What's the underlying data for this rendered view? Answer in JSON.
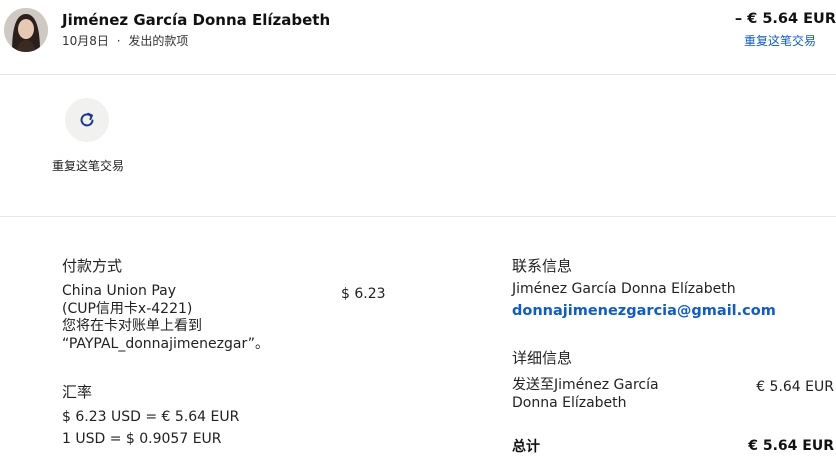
{
  "header": {
    "name": "Jiménez García Donna Elízabeth",
    "date": "10月8日",
    "separator": "·",
    "type": "发出的款项",
    "amount": "– € 5.64 EUR",
    "repeat_link": "重复这笔交易"
  },
  "actions": {
    "repeat_label": "重复这笔交易"
  },
  "payment": {
    "heading": "付款方式",
    "method_lines": [
      "China Union Pay",
      "(CUP信用卡x-4221)",
      "您将在卡对账单上看到",
      "“PAYPAL_donnajimenezgar”。"
    ],
    "method_amount": "$ 6.23"
  },
  "exchange": {
    "heading": "汇率",
    "line1": "$ 6.23 USD = € 5.64 EUR",
    "line2": "1 USD = $ 0.9057 EUR"
  },
  "contact": {
    "heading": "联系信息",
    "name": "Jiménez García Donna Elízabeth",
    "email": "donnajimenezgarcia@gmail.com"
  },
  "details": {
    "heading": "详细信息",
    "sent_to_lines": [
      "发送至Jiménez García",
      "Donna Elízabeth"
    ],
    "sent_amount": "€ 5.64 EUR",
    "total_label": "总计",
    "total_amount": "€ 5.64 EUR"
  },
  "colors": {
    "link": "#0d5bd0",
    "divider": "#e6e6e6",
    "button_bg": "#f1f2f0"
  },
  "icons": {
    "repeat": "refresh-icon",
    "avatar": "user-avatar"
  }
}
